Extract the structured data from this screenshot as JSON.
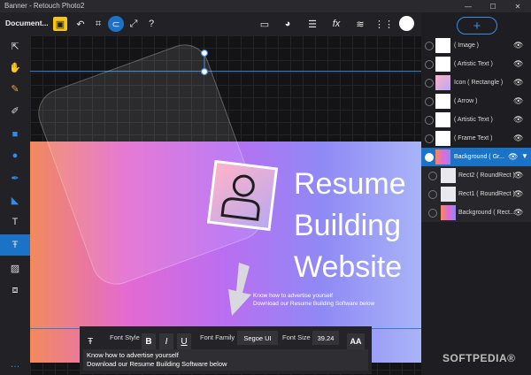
{
  "window": {
    "title": "Banner - Retouch Photo2",
    "minimize": "—",
    "maximize": "☐",
    "close": "✕"
  },
  "toolbar": {
    "document_label": "Document..."
  },
  "canvas": {
    "headline_lines": [
      "Resume",
      "Building",
      "Website"
    ],
    "caption_lines": [
      "Know how to advertise yourself",
      "Download our Resume Building Software below"
    ]
  },
  "text_panel": {
    "font_style_label": "Font Style",
    "bold": "B",
    "italic": "I",
    "underline": "U",
    "font_family_label": "Font Family",
    "font_family_value": "Segoe UI",
    "font_size_label": "Font Size",
    "font_size_value": "39.24",
    "text_lines": [
      "Know how to advertise yourself",
      "Download our Resume Building Software below"
    ]
  },
  "layers": {
    "add_label": "+",
    "items": [
      {
        "label": "( Image )"
      },
      {
        "label": "( Artistic Text )"
      },
      {
        "label": "Icon ( Rectangle )"
      },
      {
        "label": "( Arrow )"
      },
      {
        "label": "( Artistic Text )"
      },
      {
        "label": "( Frame Text )"
      },
      {
        "label": "Background ( Gr..."
      },
      {
        "label": "Rect2 ( RoundRect )"
      },
      {
        "label": "Rect1 ( RoundRect )"
      },
      {
        "label": "Background ( Rect..."
      }
    ]
  },
  "watermark": "SOFTPEDIA®"
}
